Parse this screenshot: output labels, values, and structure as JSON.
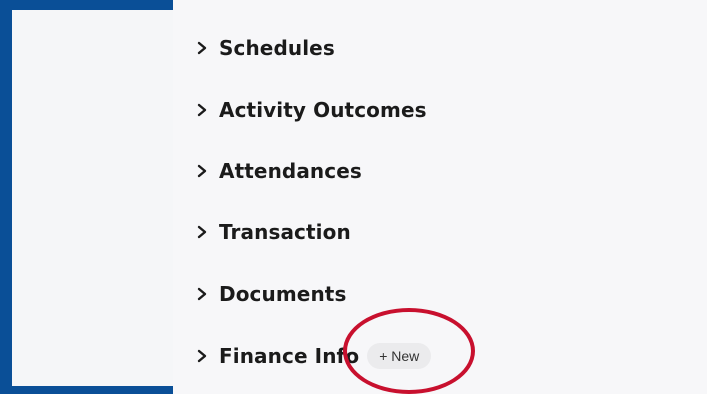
{
  "sections": [
    {
      "label": "Schedules",
      "icon": "chevron-right-icon"
    },
    {
      "label": "Activity Outcomes",
      "icon": "chevron-right-icon"
    },
    {
      "label": "Attendances",
      "icon": "chevron-right-icon"
    },
    {
      "label": "Transaction",
      "icon": "chevron-right-icon"
    },
    {
      "label": "Documents",
      "icon": "chevron-right-icon"
    },
    {
      "label": "Finance Info",
      "icon": "chevron-right-icon",
      "action_label": "+ New"
    }
  ],
  "colors": {
    "frame": "#0a4f97",
    "highlight_ring": "#c8102e",
    "button_bg": "#ebebed"
  }
}
